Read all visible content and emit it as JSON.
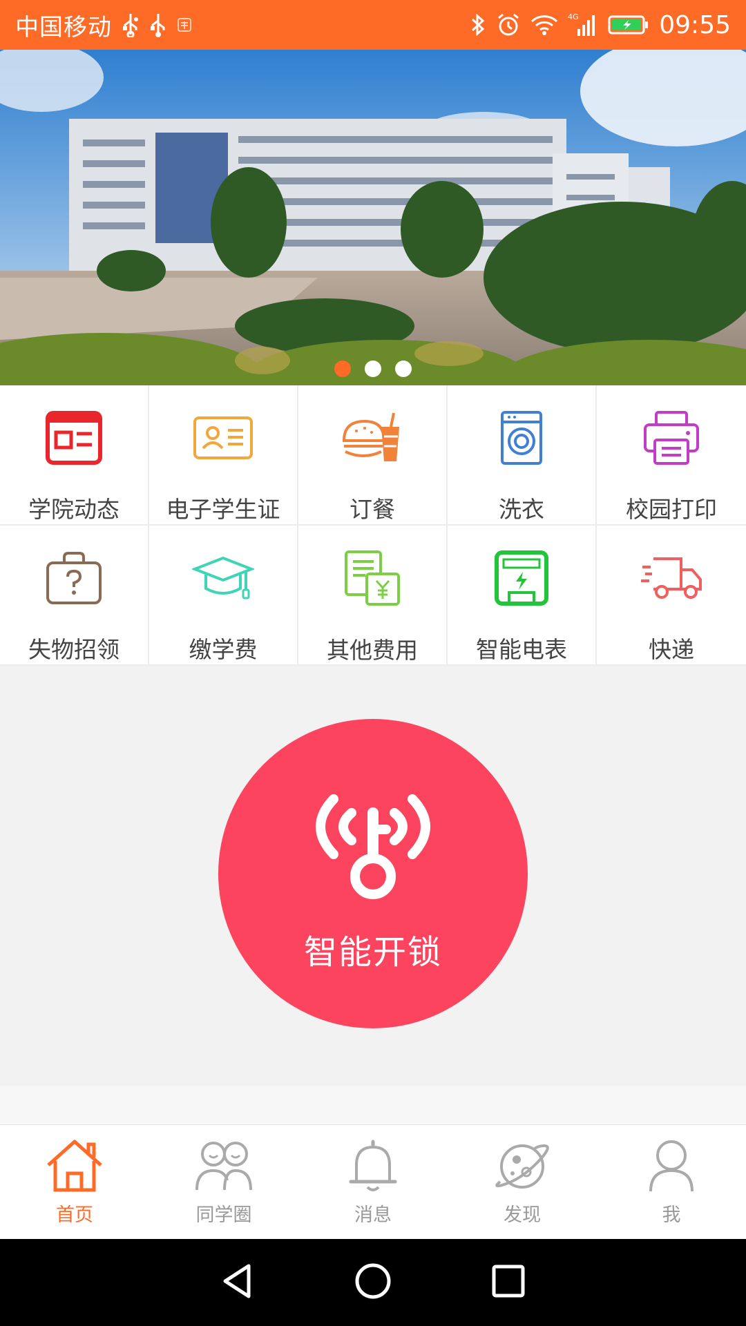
{
  "status_bar": {
    "carrier": "中国移动",
    "time": "09:55",
    "network": "4G",
    "icons": [
      "usb-icon",
      "usb-icon",
      "taobao-icon",
      "bluetooth-icon",
      "alarm-icon",
      "wifi-icon",
      "signal-icon",
      "battery-charging-icon"
    ],
    "color": "#fe6b26"
  },
  "banner": {
    "slides": 3,
    "active_slide": 1
  },
  "services": [
    {
      "label": "学院动态",
      "icon": "news-icon",
      "color": "#e8262b"
    },
    {
      "label": "电子学生证",
      "icon": "id-card-icon",
      "color": "#f2a63c"
    },
    {
      "label": "订餐",
      "icon": "burger-drink-icon",
      "color": "#f0823a"
    },
    {
      "label": "洗衣",
      "icon": "washing-machine-icon",
      "color": "#3f7fd6"
    },
    {
      "label": "校园打印",
      "icon": "printer-icon",
      "color": "#c43bc7"
    },
    {
      "label": "失物招领",
      "icon": "lost-found-bag-icon",
      "color": "#8a6a52"
    },
    {
      "label": "缴学费",
      "icon": "graduation-cap-icon",
      "color": "#3fd3b8"
    },
    {
      "label": "其他费用",
      "icon": "bill-yuan-icon",
      "color": "#7ccf45"
    },
    {
      "label": "智能电表",
      "icon": "electric-meter-icon",
      "color": "#22c43a"
    },
    {
      "label": "快递",
      "icon": "delivery-truck-icon",
      "color": "#f25d5d"
    }
  ],
  "unlock": {
    "label": "智能开锁",
    "icon": "wireless-key-icon",
    "color": "#fc445e"
  },
  "tabs": [
    {
      "label": "首页",
      "icon": "home-icon",
      "active": true
    },
    {
      "label": "同学圈",
      "icon": "classmates-icon",
      "active": false
    },
    {
      "label": "消息",
      "icon": "bell-icon",
      "active": false
    },
    {
      "label": "发现",
      "icon": "planet-icon",
      "active": false
    },
    {
      "label": "我",
      "icon": "user-icon",
      "active": false
    }
  ],
  "nav_bar": [
    "back-icon",
    "home-circle-icon",
    "recents-icon"
  ]
}
